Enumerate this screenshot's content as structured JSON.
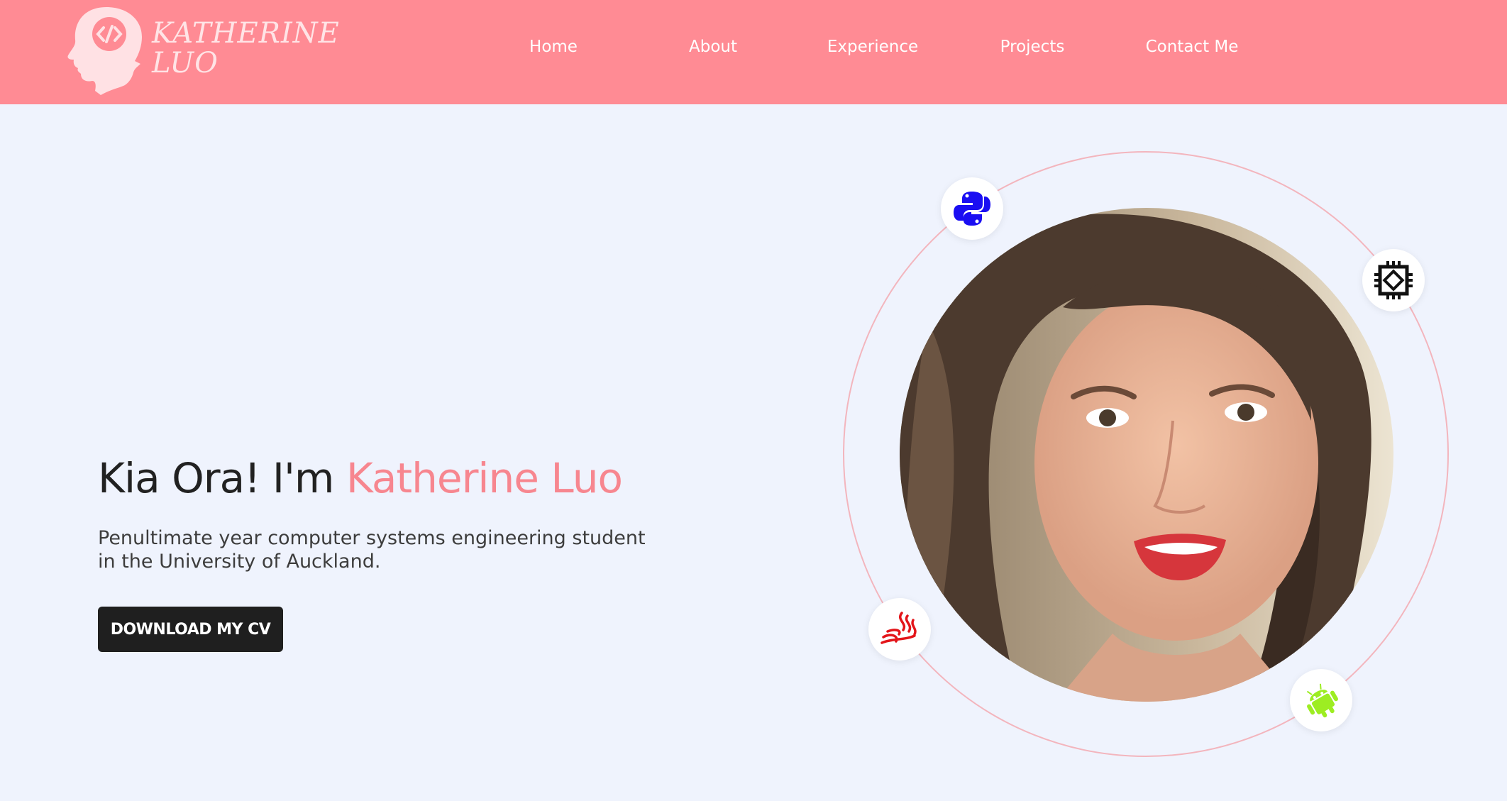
{
  "brand": {
    "line1": "KATHERINE",
    "line2": "LUO",
    "icon": "woman-head-code-icon"
  },
  "nav": {
    "items": [
      {
        "label": "Home"
      },
      {
        "label": "About"
      },
      {
        "label": "Experience"
      },
      {
        "label": "Projects"
      },
      {
        "label": "Contact Me"
      }
    ]
  },
  "hero": {
    "greeting": "Kia Ora! I'm",
    "name": "Katherine Luo",
    "subtitle_line1": "Penultimate year computer systems engineering student",
    "subtitle_line2": "in the University of Auckland.",
    "cta": "DOWNLOAD MY CV"
  },
  "skills": [
    {
      "icon": "python-icon",
      "color": "#1a0ef2"
    },
    {
      "icon": "chip-icon",
      "color": "#111111"
    },
    {
      "icon": "java-icon",
      "color": "#e3151a"
    },
    {
      "icon": "android-icon",
      "color": "#9ded22"
    }
  ],
  "colors": {
    "nav_bg": "#ff8b94",
    "accent": "#f7868f",
    "page_bg": "#eff3fd",
    "button_bg": "#1f1f1f"
  }
}
